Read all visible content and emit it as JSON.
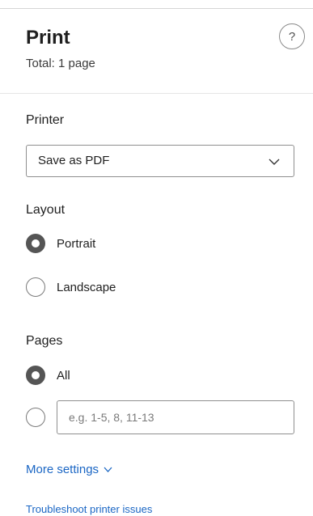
{
  "header": {
    "title": "Print",
    "subtitle": "Total: 1 page",
    "help_label": "?"
  },
  "printer": {
    "label": "Printer",
    "selected": "Save as PDF",
    "icon": "chevron-down-icon"
  },
  "layout": {
    "label": "Layout",
    "options": [
      {
        "label": "Portrait",
        "checked": true
      },
      {
        "label": "Landscape",
        "checked": false
      }
    ]
  },
  "pages": {
    "label": "Pages",
    "all_label": "All",
    "all_checked": true,
    "custom_checked": false,
    "custom_placeholder": "e.g. 1-5, 8, 11-13",
    "custom_value": ""
  },
  "links": {
    "more_settings": "More settings",
    "troubleshoot": "Troubleshoot printer issues"
  },
  "colors": {
    "link": "#1a66c4",
    "radio_checked": "#555555",
    "border": "#8f8f8f"
  }
}
